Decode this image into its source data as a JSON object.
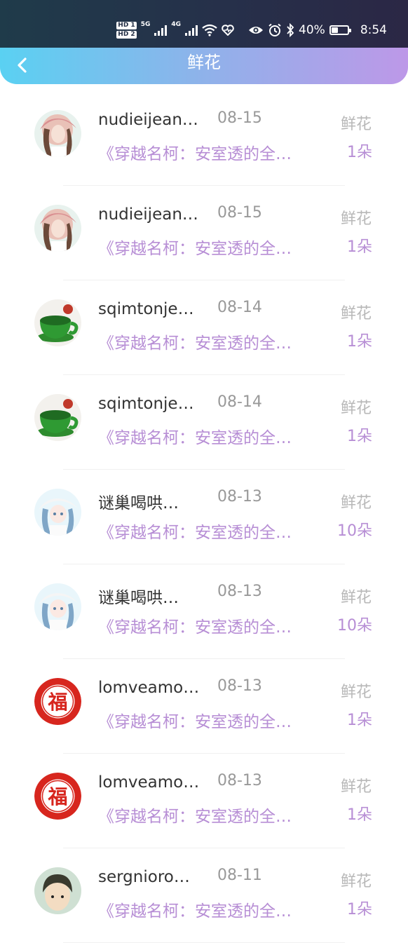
{
  "status_bar": {
    "sim1": "HD 1",
    "sim2": "HD 2",
    "net1": "5G",
    "net2": "4G",
    "battery_percent": "40%",
    "time": "8:54",
    "icons": [
      "signal-icon",
      "wifi-icon",
      "heart-icon",
      "eye-icon",
      "alarm-icon",
      "bluetooth-icon",
      "battery-icon"
    ]
  },
  "header": {
    "title": "鲜花",
    "back_icon": "chevron-left-icon"
  },
  "colors": {
    "header_start": "#5ad1f2",
    "header_end": "#bd98e8",
    "accent": "#b78ed5"
  },
  "rows": [
    {
      "name": "nudieijean…",
      "date": "08-15",
      "type": "鲜花",
      "book": "《穿越名柯：安室透的全…",
      "qty": "1朵",
      "avatar": "girl-hat"
    },
    {
      "name": "nudieijean…",
      "date": "08-15",
      "type": "鲜花",
      "book": "《穿越名柯：安室透的全…",
      "qty": "1朵",
      "avatar": "girl-hat"
    },
    {
      "name": "sqimtonje…",
      "date": "08-14",
      "type": "鲜花",
      "book": "《穿越名柯：安室透的全…",
      "qty": "1朵",
      "avatar": "green-cup"
    },
    {
      "name": "sqimtonje…",
      "date": "08-14",
      "type": "鲜花",
      "book": "《穿越名柯：安室透的全…",
      "qty": "1朵",
      "avatar": "green-cup"
    },
    {
      "name": "谜巢喝哄…",
      "date": "08-13",
      "type": "鲜花",
      "book": "《穿越名柯：安室透的全…",
      "qty": "10朵",
      "avatar": "anime-girl"
    },
    {
      "name": "谜巢喝哄…",
      "date": "08-13",
      "type": "鲜花",
      "book": "《穿越名柯：安室透的全…",
      "qty": "10朵",
      "avatar": "anime-girl"
    },
    {
      "name": "lomveamo…",
      "date": "08-13",
      "type": "鲜花",
      "book": "《穿越名柯：安室透的全…",
      "qty": "1朵",
      "avatar": "fu-seal"
    },
    {
      "name": "lomveamo…",
      "date": "08-13",
      "type": "鲜花",
      "book": "《穿越名柯：安室透的全…",
      "qty": "1朵",
      "avatar": "fu-seal"
    },
    {
      "name": "sergnioro…",
      "date": "08-11",
      "type": "鲜花",
      "book": "《穿越名柯：安室透的全…",
      "qty": "1朵",
      "avatar": "boy"
    }
  ]
}
